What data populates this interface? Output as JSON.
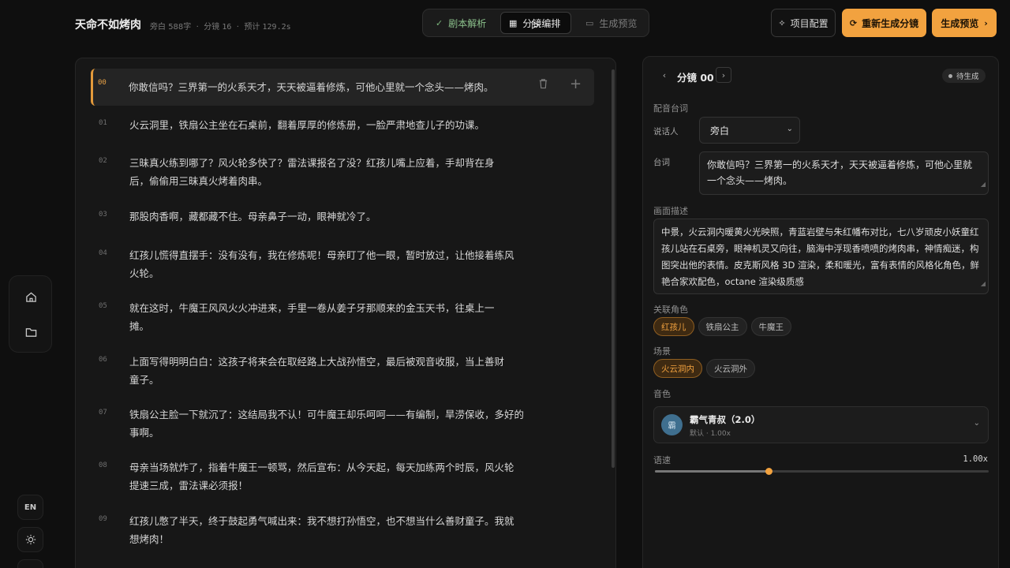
{
  "header": {
    "title": "天命不如烤肉",
    "meta": {
      "narration_label": "旁白",
      "char_count": "588字",
      "sep": "·",
      "segments_label": "分镜",
      "segments": "16",
      "estimate_label": "预计",
      "estimate": "129.2s"
    },
    "steps": [
      {
        "label": "剧本解析",
        "icon": "✓"
      },
      {
        "label": "分镜编排",
        "icon": "▦"
      },
      {
        "label": "生成预览",
        "icon": "▭"
      }
    ],
    "buttons": {
      "config": "项目配置",
      "regenerate": "重新生成分镜",
      "preview": "生成预览"
    }
  },
  "sidebar": {
    "language": "EN"
  },
  "script": {
    "rows": [
      {
        "num": "00",
        "text": "你敢信吗？三界第一的火系天才，天天被逼着修炼，可他心里就一个念头——烤肉。"
      },
      {
        "num": "01",
        "text": "火云洞里，铁扇公主坐在石桌前，翻着厚厚的修炼册，一脸严肃地查儿子的功课。"
      },
      {
        "num": "02",
        "text": "三昧真火练到哪了？风火轮多快了？雷法课报名了没？红孩儿嘴上应着，手却背在身后，偷偷用三昧真火烤着肉串。"
      },
      {
        "num": "03",
        "text": "那股肉香啊，藏都藏不住。母亲鼻子一动，眼神就冷了。"
      },
      {
        "num": "04",
        "text": "红孩儿慌得直摆手：没有没有，我在修炼呢！母亲盯了他一眼，暂时放过，让他接着练风火轮。"
      },
      {
        "num": "05",
        "text": "就在这时，牛魔王风风火火冲进来，手里一卷从姜子牙那顺来的金玉天书，往桌上一摊。"
      },
      {
        "num": "06",
        "text": "上面写得明明白白：这孩子将来会在取经路上大战孙悟空，最后被观音收服，当上善财童子。"
      },
      {
        "num": "07",
        "text": "铁扇公主脸一下就沉了：这结局我不认！可牛魔王却乐呵呵——有编制，旱涝保收，多好的事啊。"
      },
      {
        "num": "08",
        "text": "母亲当场就炸了，指着牛魔王一顿骂，然后宣布：从今天起，每天加练两个时辰，风火轮提速三成，雷法课必须报！"
      },
      {
        "num": "09",
        "text": "红孩儿憋了半天，终于鼓起勇气喊出来：我不想打孙悟空，也不想当什么善财童子。我就想烤肉！"
      }
    ]
  },
  "detail": {
    "segment_title": "分镜 00",
    "status": "待生成",
    "dub_section": "配音台词",
    "speaker_label": "说话人",
    "speaker_value": "旁白",
    "line_label": "台词",
    "line_value": "你敢信吗？三界第一的火系天才，天天被逼着修炼，可他心里就一个念头——烤肉。",
    "desc_label": "画面描述",
    "desc_value": "中景，火云洞内暖黄火光映照，青蓝岩壁与朱红幡布对比，七八岁顽皮小妖童红孩儿站在石桌旁，眼神机灵又向往，脑海中浮现香喷喷的烤肉串，神情痴迷，构图突出他的表情。皮克斯风格 3D 渲染，柔和暖光，富有表情的风格化角色，鲜艳合家欢配色，octane 渲染级质感",
    "characters_label": "关联角色",
    "characters": [
      {
        "label": "红孩儿",
        "selected": true
      },
      {
        "label": "铁扇公主",
        "selected": false
      },
      {
        "label": "牛魔王",
        "selected": false
      }
    ],
    "scene_label": "场景",
    "scenes": [
      {
        "label": "火云洞内",
        "selected": true
      },
      {
        "label": "火云洞外",
        "selected": false
      }
    ],
    "voice_label": "音色",
    "voice": {
      "avatar": "霸",
      "name": "霸气青叔（2.0）",
      "sub": "默认 · 1.00x"
    },
    "speed_label": "语速",
    "speed_value": "1.00x",
    "speed_fraction": 0.34
  },
  "colors": {
    "accent": "#f2a23f",
    "background": "#0f0f0f",
    "panel": "#171717",
    "done_step": "#8bc08b"
  }
}
